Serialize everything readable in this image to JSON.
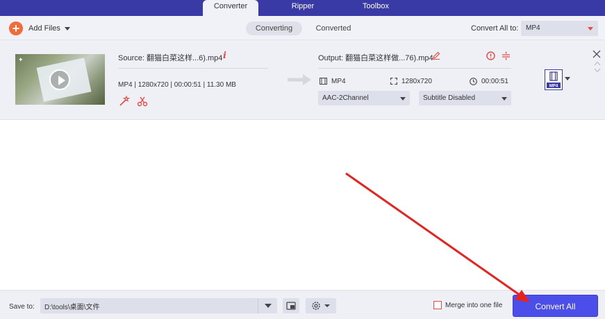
{
  "nav": {
    "tabs": [
      {
        "label": "Converter"
      },
      {
        "label": "Ripper"
      },
      {
        "label": "Toolbox"
      }
    ]
  },
  "toolbar": {
    "add_files_label": "Add Files",
    "segments": [
      {
        "label": "Converting"
      },
      {
        "label": "Converted"
      }
    ],
    "convert_all_to_label": "Convert All to:",
    "format_value": "MP4"
  },
  "file": {
    "source_label": "Source: 翻猫白菜这样...6).mp4",
    "source_meta": "MP4 | 1280x720 | 00:00:51 | 11.30 MB",
    "output_label": "Output: 翻猫白菜这样做...76).mp4",
    "output_format": "MP4",
    "output_resolution": "1280x720",
    "output_duration": "00:00:51",
    "audio_value": "AAC-2Channel",
    "subtitle_value": "Subtitle Disabled",
    "format_badge": "MP4"
  },
  "bottom": {
    "save_to_label": "Save to:",
    "path_value": "D:\\tools\\桌面\\文件",
    "merge_label": "Merge into one file",
    "convert_all_label": "Convert All"
  },
  "colors": {
    "accent": "#3a3aa6",
    "primary_button": "#4b4ee8",
    "danger": "#e34d44",
    "add_button": "#f26b3a"
  }
}
